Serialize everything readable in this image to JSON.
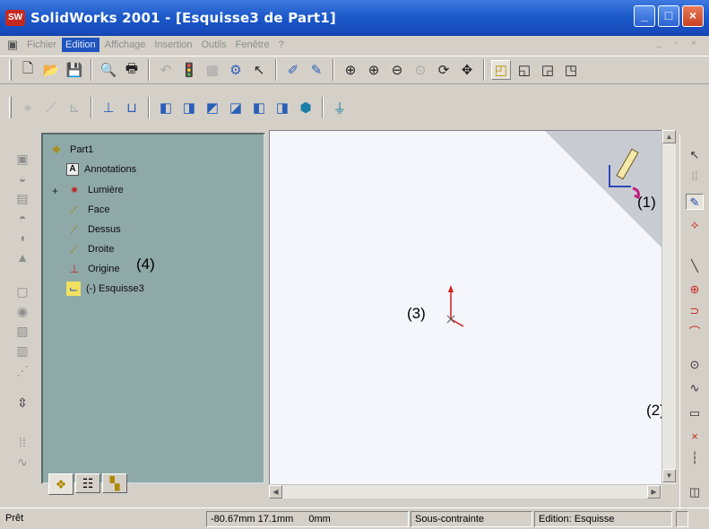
{
  "window": {
    "app_icon_text": "SW",
    "title": "SolidWorks 2001 - [Esquisse3 de Part1]",
    "minimize": "_",
    "maximize": "□",
    "close": "×"
  },
  "menu": {
    "items": [
      "Fichier",
      "Edition",
      "Affichage",
      "Insertion",
      "Outils",
      "Fenêtre",
      "?"
    ],
    "active_index": 1,
    "mdi_controls": "_ ▫ ×"
  },
  "tree": {
    "root": "Part1",
    "items": [
      {
        "label": "Annotations",
        "icon": "annotations-icon"
      },
      {
        "label": "Lumière",
        "icon": "light-icon"
      },
      {
        "label": "Face",
        "icon": "plane-icon"
      },
      {
        "label": "Dessus",
        "icon": "plane-icon"
      },
      {
        "label": "Droite",
        "icon": "plane-icon"
      },
      {
        "label": "Origine",
        "icon": "origin-icon"
      },
      {
        "label": "(-) Esquisse3",
        "icon": "sketch-icon"
      }
    ],
    "expand_marker": "+"
  },
  "callouts": {
    "c1": "(1)",
    "c2": "(2)",
    "c3": "(3)",
    "c4": "(4)"
  },
  "status": {
    "ready": "Prêt",
    "coords": "-80.67mm 17.1mm",
    "z": "0mm",
    "constraint": "Sous-contrainte",
    "mode": "Edition: Esquisse"
  },
  "colors": {
    "titlebar": "#1a58c8",
    "tree_bg": "#8fa8a8",
    "graphics_bg": "#f5f6fb",
    "origin_red": "#d81e1e"
  }
}
